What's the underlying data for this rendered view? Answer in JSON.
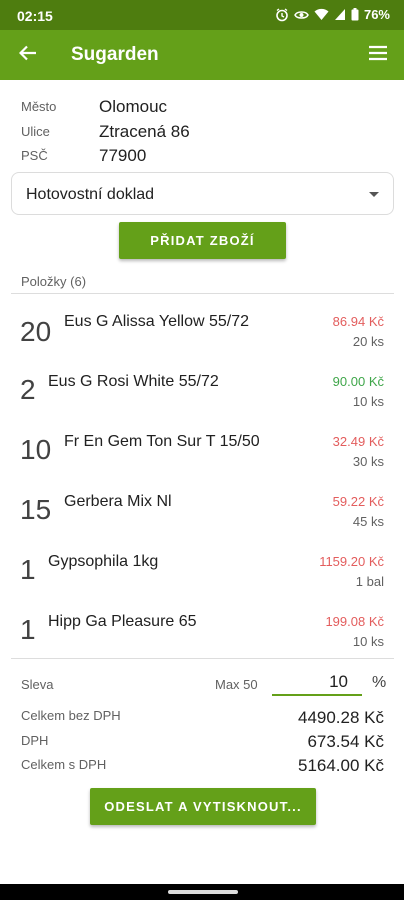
{
  "status_bar": {
    "time": "02:15",
    "battery": "76%"
  },
  "app_bar": {
    "title": "Sugarden"
  },
  "address": {
    "city_label": "Město",
    "city_value": "Olomouc",
    "street_label": "Ulice",
    "street_value": "Ztracená 86",
    "zip_label": "PSČ",
    "zip_value": "77900"
  },
  "document_type": {
    "selected": "Hotovostní doklad"
  },
  "add_goods_label": "PŘIDAT ZBOŽÍ",
  "items_header": "Položky (6)",
  "items": [
    {
      "qty": "20",
      "name": "Eus G Alissa Yellow 55/72",
      "price": "86.94 Kč",
      "unit": "20 ks",
      "price_color": "red"
    },
    {
      "qty": "2",
      "name": "Eus G Rosi White 55/72",
      "price": "90.00 Kč",
      "unit": "10 ks",
      "price_color": "green"
    },
    {
      "qty": "10",
      "name": "Fr En Gem Ton Sur T 15/50",
      "price": "32.49 Kč",
      "unit": "30 ks",
      "price_color": "red"
    },
    {
      "qty": "15",
      "name": "Gerbera Mix Nl",
      "price": "59.22 Kč",
      "unit": "45 ks",
      "price_color": "red"
    },
    {
      "qty": "1",
      "name": "Gypsophila 1kg",
      "price": "1159.20 Kč",
      "unit": "1 bal",
      "price_color": "red"
    },
    {
      "qty": "1",
      "name": "Hipp Ga Pleasure 65",
      "price": "199.08 Kč",
      "unit": "10 ks",
      "price_color": "red"
    }
  ],
  "discount": {
    "label": "Sleva",
    "max_label": "Max 50",
    "value": "10",
    "unit": "%"
  },
  "summary": {
    "without_vat_label": "Celkem bez DPH",
    "without_vat_value": "4490.28 Kč",
    "vat_label": "DPH",
    "vat_value": "673.54 Kč",
    "with_vat_label": "Celkem s DPH",
    "with_vat_value": "5164.00 Kč"
  },
  "submit_label": "ODESLAT A VYTISKNOUT...",
  "colors": {
    "primary": "#64a019",
    "status_bar": "#4e7d0f",
    "price_red": "#e35d5d",
    "price_green": "#3fa64a"
  }
}
